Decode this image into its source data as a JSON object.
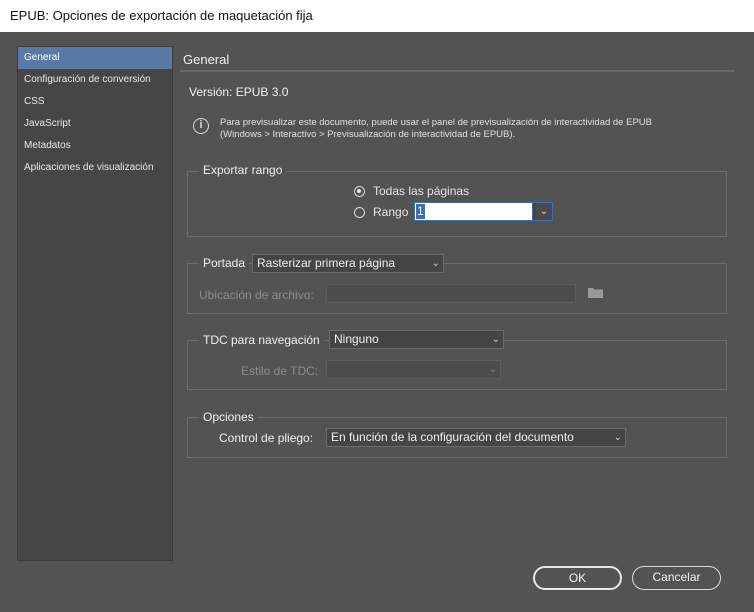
{
  "window": {
    "title": "EPUB: Opciones de exportación de maquetación fija"
  },
  "sidebar": {
    "items": [
      {
        "label": "General",
        "active": true
      },
      {
        "label": "Configuración de conversión",
        "active": false
      },
      {
        "label": "CSS",
        "active": false
      },
      {
        "label": "JavaScript",
        "active": false
      },
      {
        "label": "Metadatos",
        "active": false
      },
      {
        "label": "Aplicaciones de visualización",
        "active": false
      }
    ]
  },
  "main": {
    "section_title": "General",
    "version": "Versión: EPUB 3.0",
    "info": {
      "icon": "info-icon",
      "line1": "Para previsualizar este documento, puede usar el panel de previsualización de interactividad de EPUB",
      "line2": "(Windows > Interactivo > Previsualización de interactividad de EPUB)."
    },
    "export_range": {
      "legend": "Exportar rango",
      "all_pages": "Todas las páginas",
      "range_label": "Rango",
      "range_value": "1",
      "selected": "all_pages"
    },
    "cover": {
      "label": "Portada",
      "value": "Rasterizar primera página",
      "file_location_label": "Ubicación de archivo:",
      "file_location_value": "",
      "folder_icon": "folder-icon"
    },
    "toc": {
      "label": "TDC para navegación",
      "value": "Ninguno",
      "style_label": "Estilo de TDC:",
      "style_value": ""
    },
    "options": {
      "legend": "Opciones",
      "spread_label": "Control de pliego:",
      "spread_value": "En función de la configuración del documento"
    }
  },
  "footer": {
    "ok": "OK",
    "cancel": "Cancelar"
  },
  "colors": {
    "background": "#535353",
    "accent": "#5a7aa6",
    "selection": "#3d6fb0"
  }
}
